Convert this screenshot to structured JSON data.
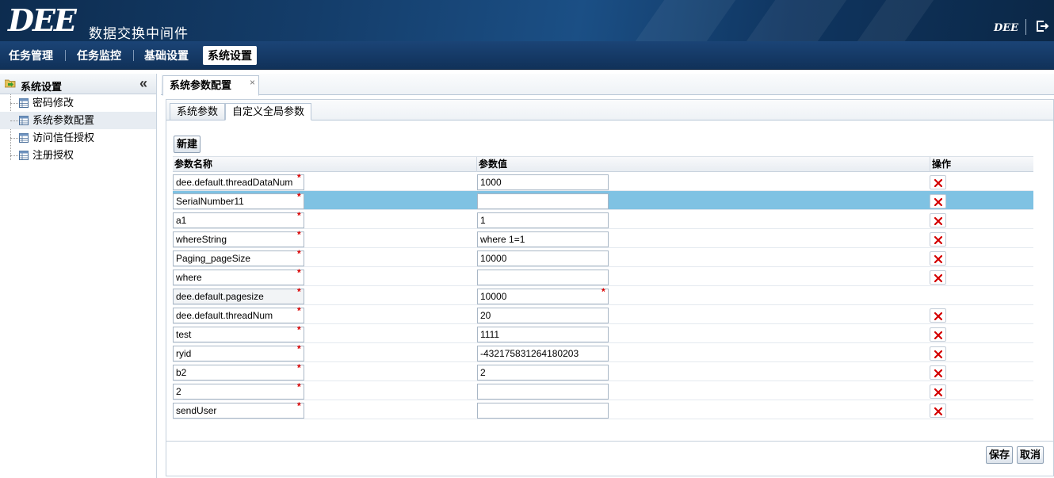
{
  "header": {
    "logo_text": "DEE",
    "app_title": "数据交换中间件",
    "brand_small": "DEE"
  },
  "nav": {
    "items": [
      {
        "label": "任务管理"
      },
      {
        "label": "任务监控"
      },
      {
        "label": "基础设置"
      },
      {
        "label": "系统设置",
        "active": true
      }
    ]
  },
  "sidebar": {
    "title": "系统设置",
    "collapse_glyph": "«",
    "items": [
      {
        "label": "密码修改"
      },
      {
        "label": "系统参数配置",
        "selected": true
      },
      {
        "label": "访问信任授权"
      },
      {
        "label": "注册授权"
      }
    ]
  },
  "main": {
    "tab": {
      "label": "系统参数配置",
      "close": "×"
    },
    "subtabs": [
      {
        "label": "系统参数"
      },
      {
        "label": "自定义全局参数",
        "active": true
      }
    ],
    "new_button": "新建",
    "columns": [
      "参数名称",
      "参数值",
      "操作"
    ],
    "rows": [
      {
        "name": "dee.default.threadDataNum",
        "value": "1000",
        "deletable": true
      },
      {
        "name": "SerialNumber11",
        "value": "",
        "deletable": true,
        "selected": true
      },
      {
        "name": "a1",
        "value": "1",
        "deletable": true
      },
      {
        "name": "whereString",
        "value": "where 1=1",
        "deletable": true
      },
      {
        "name": "Paging_pageSize",
        "value": "10000",
        "deletable": true
      },
      {
        "name": "where",
        "value": "",
        "deletable": true
      },
      {
        "name": "dee.default.pagesize",
        "value": "10000",
        "deletable": false,
        "readonly": true
      },
      {
        "name": "dee.default.threadNum",
        "value": "20",
        "deletable": true
      },
      {
        "name": "test",
        "value": "1111",
        "deletable": true
      },
      {
        "name": "ryid",
        "value": "-432175831264180203",
        "deletable": true
      },
      {
        "name": "b2",
        "value": "2",
        "deletable": true
      },
      {
        "name": "2",
        "value": "",
        "deletable": true
      },
      {
        "name": "sendUser",
        "value": "",
        "deletable": true
      }
    ],
    "required_mark": "*",
    "save_button": "保存",
    "cancel_button": "取消"
  },
  "colors": {
    "header_dark": "#0d2c4f",
    "selected_row": "#7fc2e3",
    "delete_red": "#d40000",
    "required_red": "#dd0000"
  }
}
